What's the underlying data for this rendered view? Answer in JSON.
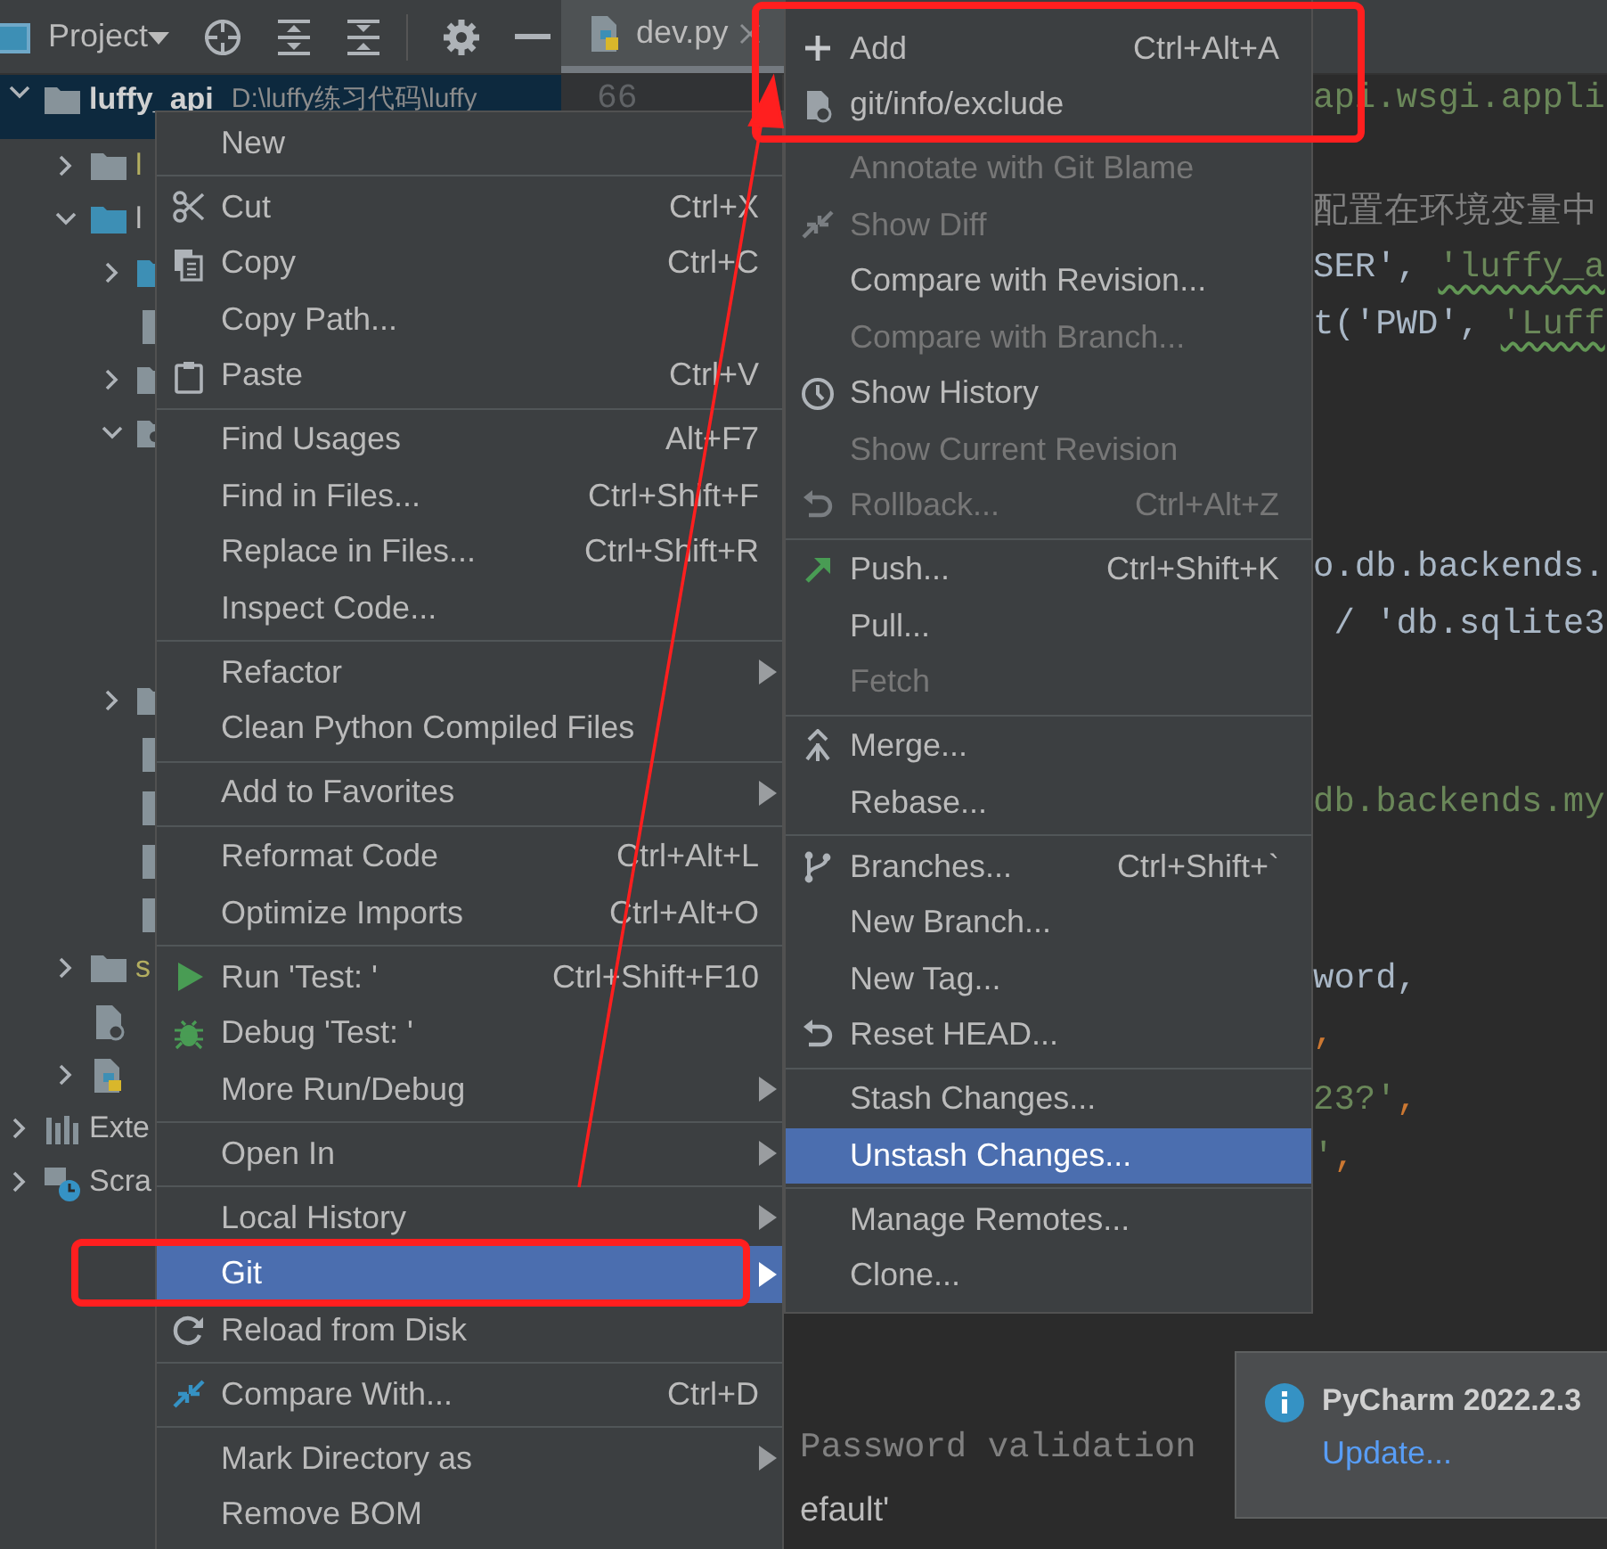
{
  "toolbar": {
    "title": "Project"
  },
  "tree": [
    {
      "label": "luffy_api",
      "path": "D:\\luffy练习代码\\luffy",
      "kind": "folder",
      "expanded": true,
      "selected": true,
      "excluded": false,
      "children": [
        {
          "label": "l",
          "kind": "folder",
          "expanded": false,
          "selected": false,
          "excluded": true
        },
        {
          "label": "l",
          "kind": "source",
          "expanded": true,
          "selected": false,
          "excluded": false,
          "children": [
            {
              "kind": "source",
              "expanded": false,
              "selected": false
            },
            {
              "kind": "file",
              "selected": false
            },
            {
              "kind": "folder",
              "expanded": false,
              "selected": false
            },
            {
              "kind": "package",
              "expanded": true,
              "selected": false
            },
            {
              "kind": "folder",
              "expanded": false,
              "selected": false
            },
            {
              "kind": "file",
              "selected": false
            },
            {
              "kind": "file",
              "selected": false
            },
            {
              "kind": "file",
              "selected": false
            },
            {
              "kind": "file",
              "selected": false
            }
          ]
        },
        {
          "label": "s",
          "kind": "folder",
          "expanded": false,
          "selected": false,
          "excluded": true
        },
        {
          "kind": "config",
          "selected": false
        },
        {
          "kind": "python",
          "expanded": false,
          "selected": false
        }
      ]
    },
    {
      "label": "Exte",
      "kind": "library",
      "expanded": false,
      "selected": false,
      "excluded": false
    },
    {
      "label": "Scra",
      "kind": "scratch",
      "expanded": false,
      "selected": false,
      "excluded": false
    }
  ],
  "tabs": [
    {
      "label": "dev.py",
      "selected": true
    }
  ],
  "editor": {
    "line_number": "66",
    "upper_lines": [
      {
        "tokens": [
          {
            "kind": "string",
            "text": "api.wsgi.appli"
          }
        ]
      },
      {
        "tokens": [
          {
            "kind": "comment",
            "text": "配置在环境变量中"
          }
        ]
      },
      {
        "tokens": [
          {
            "kind": "plain",
            "text": "SER', "
          },
          {
            "kind": "string",
            "text": "'luffy_a",
            "typo": true
          }
        ]
      },
      {
        "tokens": [
          {
            "kind": "plain",
            "text": "t('PWD', "
          },
          {
            "kind": "string",
            "text": "'Luff",
            "typo": true
          }
        ]
      },
      {
        "tokens": [
          {
            "kind": "plain",
            "text": "o.db.backends."
          }
        ]
      },
      {
        "tokens": [
          {
            "kind": "plain",
            "text": " / 'db.sqlite3"
          }
        ]
      },
      {
        "tokens": [
          {
            "kind": "string",
            "text": "db.backends.my"
          }
        ]
      },
      {
        "tokens": [
          {
            "kind": "plain",
            "text": "word,"
          }
        ]
      },
      {
        "tokens": [
          {
            "kind": "keyword",
            "text": ","
          }
        ]
      },
      {
        "tokens": [
          {
            "kind": "string",
            "text": "23?'"
          },
          {
            "kind": "keyword",
            "text": ","
          }
        ]
      },
      {
        "tokens": [
          {
            "kind": "string",
            "text": "'"
          },
          {
            "kind": "keyword",
            "text": ","
          }
        ]
      }
    ],
    "lower_lines": [
      {
        "tokens": [
          {
            "kind": "comment",
            "text": "Password validation"
          }
        ]
      },
      {
        "tokens": [
          {
            "kind": "label",
            "text": "efault'"
          }
        ]
      }
    ]
  },
  "context_menu": {
    "groups": [
      {
        "items": [
          {
            "label": "New",
            "submenu": false,
            "selected": false
          }
        ]
      },
      {
        "items": [
          {
            "label": "Cut",
            "shortcut": "Ctrl+X",
            "kind": "cut",
            "submenu": false,
            "selected": false
          },
          {
            "label": "Copy",
            "shortcut": "Ctrl+C",
            "kind": "copy",
            "submenu": false,
            "selected": false
          },
          {
            "label": "Copy Path...",
            "submenu": false,
            "selected": false
          },
          {
            "label": "Paste",
            "shortcut": "Ctrl+V",
            "kind": "paste",
            "submenu": false,
            "selected": false
          }
        ]
      },
      {
        "items": [
          {
            "label": "Find Usages",
            "shortcut": "Alt+F7",
            "submenu": false,
            "selected": false
          },
          {
            "label": "Find in Files...",
            "shortcut": "Ctrl+Shift+F",
            "submenu": false,
            "selected": false
          },
          {
            "label": "Replace in Files...",
            "shortcut": "Ctrl+Shift+R",
            "submenu": false,
            "selected": false
          },
          {
            "label": "Inspect Code...",
            "submenu": false,
            "selected": false
          }
        ]
      },
      {
        "items": [
          {
            "label": "Refactor",
            "submenu": true,
            "selected": false
          },
          {
            "label": "Clean Python Compiled Files",
            "submenu": false,
            "selected": false
          }
        ]
      },
      {
        "items": [
          {
            "label": "Add to Favorites",
            "submenu": true,
            "selected": false
          }
        ]
      },
      {
        "items": [
          {
            "label": "Reformat Code",
            "shortcut": "Ctrl+Alt+L",
            "submenu": false,
            "selected": false
          },
          {
            "label": "Optimize Imports",
            "shortcut": "Ctrl+Alt+O",
            "submenu": false,
            "selected": false
          }
        ]
      },
      {
        "items": [
          {
            "label": "Run 'Test: '",
            "shortcut": "Ctrl+Shift+F10",
            "kind": "run",
            "submenu": false,
            "selected": false
          },
          {
            "label": "Debug 'Test: '",
            "kind": "debug",
            "submenu": false,
            "selected": false
          },
          {
            "label": "More Run/Debug",
            "submenu": true,
            "selected": false
          }
        ]
      },
      {
        "items": [
          {
            "label": "Open In",
            "submenu": true,
            "selected": false
          }
        ]
      },
      {
        "items": [
          {
            "label": "Local History",
            "submenu": true,
            "selected": false
          },
          {
            "label": "Git",
            "submenu": true,
            "selected": true
          },
          {
            "label": "Reload from Disk",
            "kind": "reload",
            "submenu": false,
            "selected": false
          }
        ]
      },
      {
        "items": [
          {
            "label": "Compare With...",
            "shortcut": "Ctrl+D",
            "kind": "compare",
            "submenu": false,
            "selected": false
          }
        ]
      },
      {
        "items": [
          {
            "label": "Mark Directory as",
            "submenu": true,
            "selected": false
          },
          {
            "label": "Remove BOM",
            "submenu": false,
            "selected": false
          }
        ]
      }
    ]
  },
  "git_menu": {
    "groups": [
      {
        "items": [
          {
            "label": "Add",
            "shortcut": "Ctrl+Alt+A",
            "kind": "add",
            "disabled": false,
            "selected": false
          },
          {
            "label": "git/info/exclude",
            "kind": "exclude",
            "disabled": false,
            "selected": false
          }
        ]
      },
      {
        "items": [
          {
            "label": "Annotate with Git Blame",
            "disabled": true,
            "selected": false
          },
          {
            "label": "Show Diff",
            "kind": "diff",
            "disabled": true,
            "selected": false
          },
          {
            "label": "Compare with Revision...",
            "disabled": false,
            "selected": false
          },
          {
            "label": "Compare with Branch...",
            "disabled": true,
            "selected": false
          },
          {
            "label": "Show History",
            "kind": "history",
            "disabled": false,
            "selected": false
          },
          {
            "label": "Show Current Revision",
            "disabled": true,
            "selected": false
          },
          {
            "label": "Rollback...",
            "shortcut": "Ctrl+Alt+Z",
            "kind": "rollback",
            "disabled": true,
            "selected": false
          }
        ]
      },
      {
        "items": [
          {
            "label": "Push...",
            "shortcut": "Ctrl+Shift+K",
            "kind": "push",
            "disabled": false,
            "selected": false
          },
          {
            "label": "Pull...",
            "disabled": false,
            "selected": false
          },
          {
            "label": "Fetch",
            "disabled": true,
            "selected": false
          }
        ]
      },
      {
        "items": [
          {
            "label": "Merge...",
            "kind": "merge",
            "disabled": false,
            "selected": false
          },
          {
            "label": "Rebase...",
            "disabled": false,
            "selected": false
          }
        ]
      },
      {
        "items": [
          {
            "label": "Branches...",
            "shortcut": "Ctrl+Shift+`",
            "kind": "branches",
            "disabled": false,
            "selected": false
          },
          {
            "label": "New Branch...",
            "disabled": false,
            "selected": false
          },
          {
            "label": "New Tag...",
            "disabled": false,
            "selected": false
          },
          {
            "label": "Reset HEAD...",
            "kind": "reset",
            "disabled": false,
            "selected": false
          }
        ]
      },
      {
        "items": [
          {
            "label": "Stash Changes...",
            "disabled": false,
            "selected": false
          },
          {
            "label": "Unstash Changes...",
            "disabled": false,
            "selected": true
          }
        ]
      },
      {
        "items": [
          {
            "label": "Manage Remotes...",
            "disabled": false,
            "selected": false
          },
          {
            "label": "Clone...",
            "disabled": false,
            "selected": false
          }
        ]
      }
    ]
  },
  "notification": {
    "title": "PyCharm 2022.2.3",
    "link": "Update..."
  },
  "annotations": [
    {
      "kind": "box"
    },
    {
      "kind": "box"
    },
    {
      "kind": "arrow"
    }
  ]
}
